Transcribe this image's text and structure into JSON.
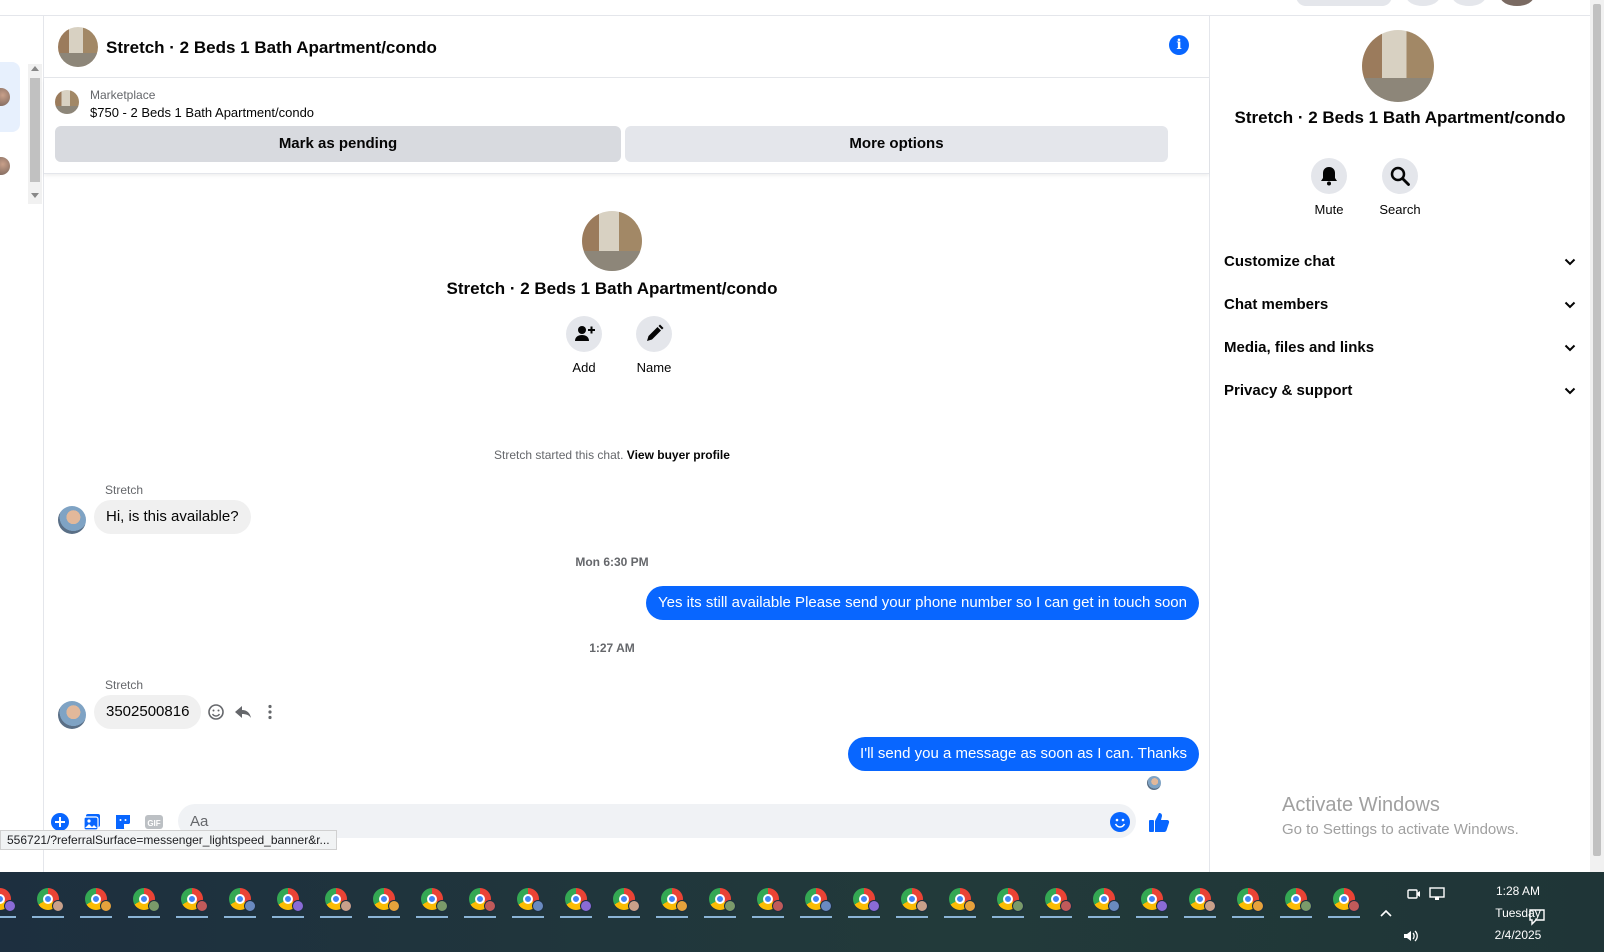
{
  "chat": {
    "title": "Stretch · 2 Beds 1 Bath Apartment/condo",
    "info_icon": "info-icon",
    "marketplace_label": "Marketplace",
    "listing": "$750 - 2 Beds 1 Bath Apartment/condo",
    "mark_pending": "Mark as pending",
    "more_options": "More options",
    "intro_title": "Stretch · 2 Beds 1 Bath Apartment/condo",
    "add_label": "Add",
    "name_label": "Name",
    "started_text": "Stretch started this chat.",
    "view_buyer_profile": "View buyer profile",
    "messages": [
      {
        "sender": "Stretch",
        "text": "Hi, is this available?"
      },
      {
        "timestamp": "Mon 6:30 PM"
      },
      {
        "text": "Yes its still available Please send your phone number so I can get in touch soon"
      },
      {
        "timestamp": "1:27 AM"
      },
      {
        "sender": "Stretch",
        "text": "3502500816"
      },
      {
        "text": "I'll send you a message as soon as I can. Thanks"
      }
    ],
    "input_placeholder": "Aa",
    "gif_label": "GIF",
    "url_tooltip": "556721/?referralSurface=messenger_lightspeed_banner&r..."
  },
  "panel": {
    "title": "Stretch · 2 Beds 1 Bath Apartment/condo",
    "mute_label": "Mute",
    "search_label": "Search",
    "sections": [
      "Customize chat",
      "Chat members",
      "Media, files and links",
      "Privacy & support"
    ]
  },
  "watermark": {
    "line1": "Activate Windows",
    "line2": "Go to Settings to activate Windows."
  },
  "taskbar": {
    "time": "1:28 AM",
    "day": "Tuesday",
    "date": "2/4/2025"
  },
  "colors": {
    "accent": "#0866ff",
    "bubble_in": "#f0f0f0",
    "button_gray": "#e4e6eb"
  }
}
